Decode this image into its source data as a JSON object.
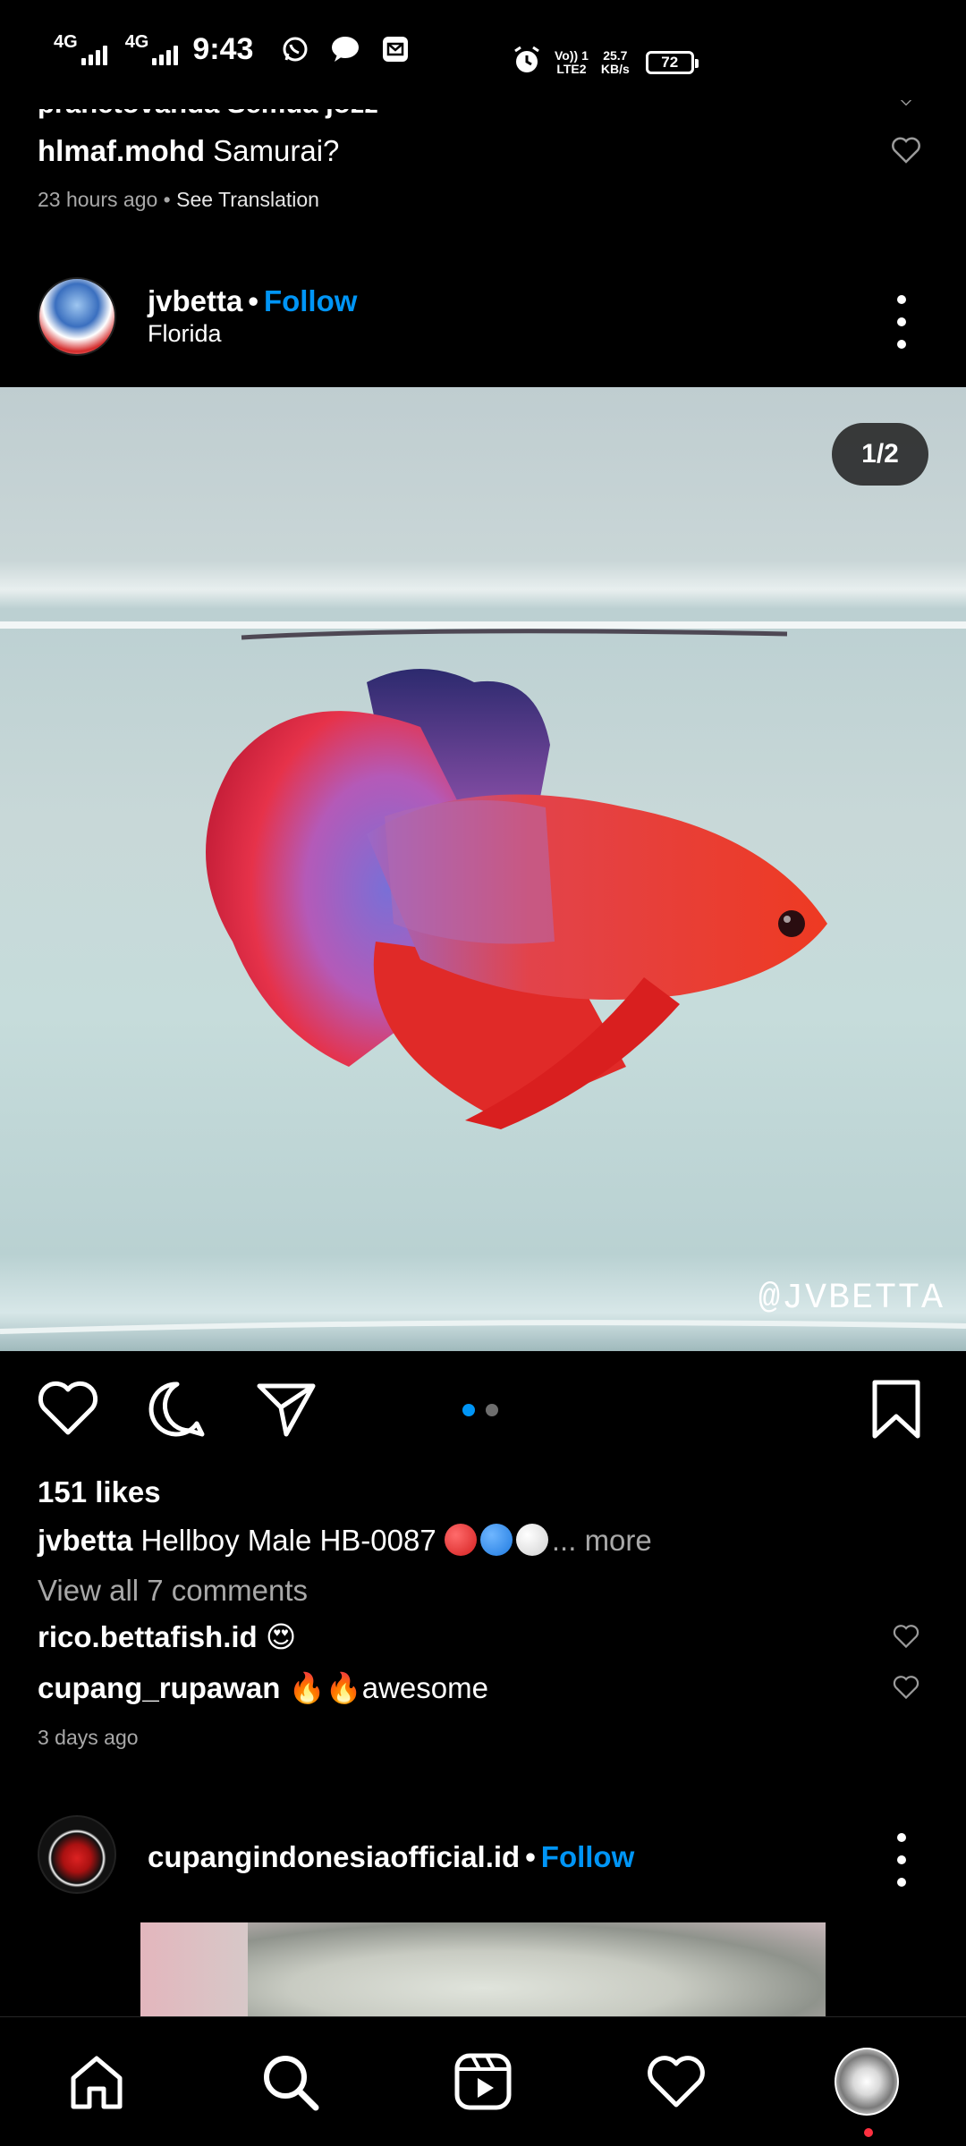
{
  "status_bar": {
    "network1": "4G",
    "network2": "4G",
    "time": "9:43",
    "volte": "Vo)) 1",
    "lte": "LTE2",
    "speed": "25.7",
    "speed_unit": "KB/s",
    "battery": "72"
  },
  "previous_comments": {
    "cut_text": "prahetovanda Semua jozz",
    "comment_user": "hlmaf.mohd",
    "comment_text": "Samurai?",
    "time_ago": "23 hours ago",
    "separator": "•",
    "see_translation": "See Translation"
  },
  "post": {
    "username": "jvbetta",
    "dot": "•",
    "follow": "Follow",
    "location": "Florida",
    "counter": "1/2",
    "watermark": "@JVBETTA",
    "likes": "151 likes",
    "caption_user": "jvbetta",
    "caption_text": "Hellboy Male HB-0087",
    "caption_more": "... more",
    "view_comments": "View all 7 comments",
    "comments": [
      {
        "user": "rico.bettafish.id",
        "text": "😍"
      },
      {
        "user": "cupang_rupawan",
        "text": "🔥🔥awesome"
      }
    ],
    "time_ago": "3 days ago",
    "carousel_total": 2,
    "carousel_active": 1
  },
  "next_post": {
    "username": "cupangindonesiaofficial.id",
    "dot": "•",
    "follow": "Follow"
  },
  "colors": {
    "accent": "#0095f6",
    "secondary_text": "#a8a8a8",
    "notification": "#ff3040"
  },
  "nav": [
    "home-icon",
    "search-icon",
    "reels-icon",
    "activity-heart-icon",
    "profile-avatar"
  ]
}
